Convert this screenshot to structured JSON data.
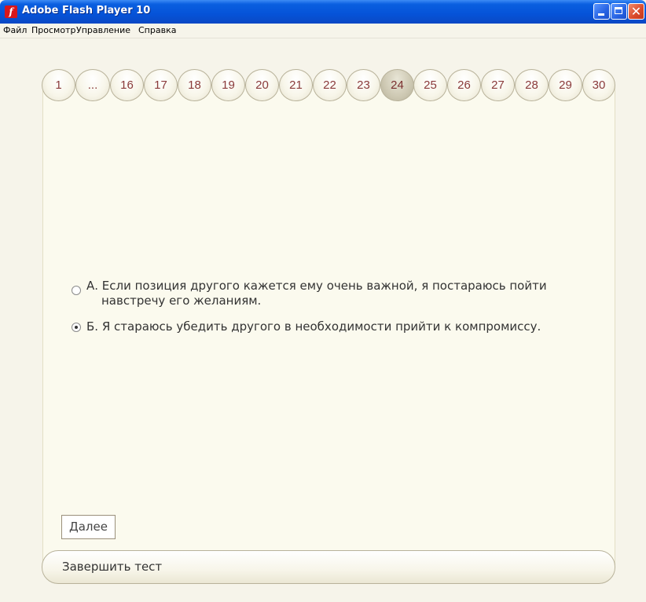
{
  "window": {
    "title": "Adobe Flash Player 10",
    "icon": "flash-icon",
    "icon_glyph": "f",
    "close_glyph": "✕"
  },
  "menu": [
    "Файл",
    "Просмотр",
    "Управление",
    "Справка"
  ],
  "tabs": [
    "1",
    "...",
    "16",
    "17",
    "18",
    "19",
    "20",
    "21",
    "22",
    "23",
    "24",
    "25",
    "26",
    "27",
    "28",
    "29",
    "30"
  ],
  "active_tab": "24",
  "answers": [
    {
      "line1": "А. Если позиция другого кажется ему очень важной, я постараюсь пойти",
      "line2": "навстречу его желаниям.",
      "selected": false
    },
    {
      "line1": "Б. Я стараюсь убедить другого в необходимости прийти к компромиссу.",
      "selected": true
    }
  ],
  "next_label": "Далее",
  "finish_label": "Завершить тест",
  "colors": {
    "titlebar": "#0553d8",
    "background": "#f6f4ea",
    "tab_text": "#8a3a3a"
  }
}
